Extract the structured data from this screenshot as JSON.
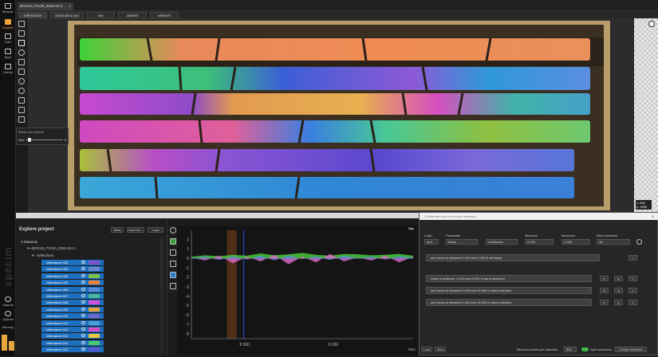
{
  "nav": {
    "items": [
      {
        "label": "Browse",
        "icon": "browse-icon"
      },
      {
        "label": "Explore",
        "icon": "explore-icon"
      },
      {
        "label": "Train",
        "icon": "train-icon"
      },
      {
        "label": "Apps",
        "icon": "apps-icon"
      },
      {
        "label": "Library",
        "icon": "library-icon"
      }
    ],
    "manual": "Manual",
    "options": "Options",
    "memory": "Memory",
    "brand": "specim"
  },
  "doc_tab": "BOX18_FX120_2024-02-2...",
  "view_tabs": [
    "reflectance",
    "darksubtracted",
    "raw",
    "darkref",
    "whiteref"
  ],
  "brush": {
    "title": "Brush tool options",
    "size_label": "Size",
    "size_value": "5"
  },
  "coords": {
    "x": "x: 592",
    "y": "y: 1690"
  },
  "explore": {
    "title": "Explore project",
    "save": "Save",
    "save_as": "Save As...",
    "load": "Load",
    "datasets": "Datasets",
    "dataset_name": "BOX18_FX120_2024-02-2...",
    "selections": "Selections",
    "rows": [
      {
        "label": "reflectance.002",
        "color": "#7a55cc"
      },
      {
        "label": "reflectance.003",
        "color": "#6a8ccf"
      },
      {
        "label": "reflectance.004",
        "color": "#7ac24a"
      },
      {
        "label": "reflectance.005",
        "color": "#e8853a"
      },
      {
        "label": "reflectance.006",
        "color": "#5a8ad8"
      },
      {
        "label": "reflectance.007",
        "color": "#46b8a0"
      },
      {
        "label": "reflectance.008",
        "color": "#d24fd8"
      },
      {
        "label": "reflectance.009",
        "color": "#e9a040"
      },
      {
        "label": "reflectance.010",
        "color": "#6a6ac8"
      },
      {
        "label": "reflectance.011",
        "color": "#4aa0d8"
      },
      {
        "label": "reflectance.012",
        "color": "#d850c8"
      },
      {
        "label": "reflectance.013",
        "color": "#e8c840"
      },
      {
        "label": "reflectance.021",
        "color": "#48c870"
      },
      {
        "label": "reflectance.022",
        "color": "#5a5ad0"
      }
    ]
  },
  "chart_data": {
    "type": "area",
    "x_ticks": [
      "8 000",
      "9 000"
    ],
    "y_ticks": [
      "2",
      "1",
      "0",
      "-1",
      "-2",
      "-3",
      "-4",
      "-5",
      "-6",
      "-7",
      "-8"
    ],
    "xlim": [
      7400,
      9900
    ],
    "ylim": [
      -8.5,
      3
    ],
    "xlabel": "Wav",
    "series": [
      {
        "color": "#4ad23a",
        "values": [
          0.2,
          0.35,
          0.25,
          0.4,
          0.3,
          0.55,
          0.35,
          0.45,
          0.6,
          0.4,
          0.3,
          0.5,
          0.45,
          0.35,
          0.4,
          0.5,
          0.3
        ]
      },
      {
        "color": "#e06ad0",
        "values": [
          0.1,
          -0.2,
          0.3,
          -0.5,
          0.2,
          -0.3,
          0.4,
          -0.6,
          0.2,
          -0.4,
          0.5,
          -0.3,
          0.1,
          -0.2,
          0.3,
          -0.4,
          0.2
        ]
      },
      {
        "color": "#5a8ad8",
        "values": [
          0.05,
          0.2,
          -0.15,
          0.25,
          -0.1,
          0.3,
          -0.2,
          0.35,
          -0.05,
          0.25,
          -0.15,
          0.3,
          0.05,
          0.2,
          -0.1,
          0.25,
          0.1
        ]
      }
    ]
  },
  "plot_tab": "Spe",
  "dialog": {
    "title": "Create selection from band selection",
    "logic_label": "Logic",
    "logic_value": "and",
    "param_label": "Parameter",
    "param_value": "Mean",
    "op_value": "is between",
    "min_label": "Minimum",
    "min_value": "0.000",
    "max_label": "Maximum",
    "max_value": "1.000",
    "band_label": "Band selection",
    "band_value": "All",
    "all_bands_rule": "and mean is between 0.000 and 1.000 in all bands",
    "rules": [
      "mean is between -0.100 and 0.200 in band selection",
      "and mean is between 0.030 and 10.000 in band selection",
      "and mean is between 0.000 and 10.000 in band selection"
    ],
    "load": "Load",
    "save": "Save",
    "min_pixels_label": "Minimum pixels per selection",
    "min_pixels_value": "500",
    "split_label": "Split selections",
    "create": "Create selection"
  }
}
